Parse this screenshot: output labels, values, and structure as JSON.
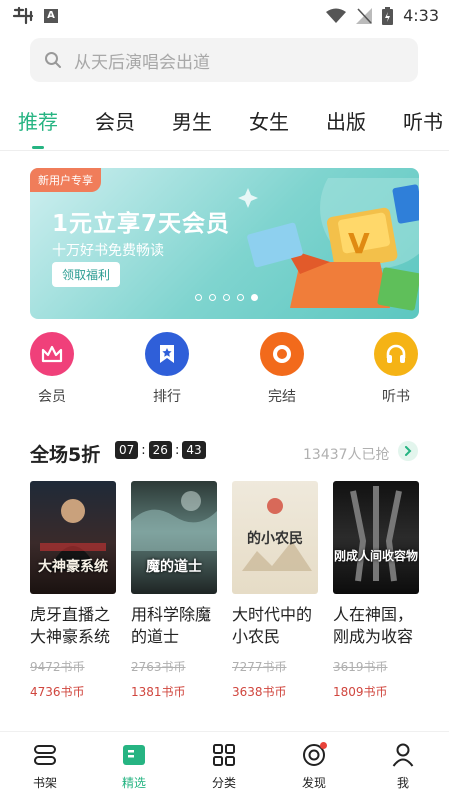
{
  "status_bar": {
    "time": "4:33",
    "app_mark": "A"
  },
  "search": {
    "placeholder": "从天后演唱会出道"
  },
  "tabs": [
    {
      "label": "推荐",
      "active": true
    },
    {
      "label": "会员"
    },
    {
      "label": "男生"
    },
    {
      "label": "女生"
    },
    {
      "label": "出版"
    },
    {
      "label": "听书"
    }
  ],
  "banner": {
    "tag": "新用户专享",
    "title": "1元立享7天会员",
    "subtitle": "十万好书免费畅读",
    "button": "领取福利",
    "slides": 5,
    "active_slide": 5
  },
  "quick_links": [
    {
      "label": "会员",
      "icon": "crown-icon",
      "color": "#f0407a"
    },
    {
      "label": "排行",
      "icon": "ranking-star-icon",
      "color": "#2f5fd9"
    },
    {
      "label": "完结",
      "icon": "ring-icon",
      "color": "#f26a1b"
    },
    {
      "label": "听书",
      "icon": "headphones-icon",
      "color": "#f5b315"
    }
  ],
  "flash_sale": {
    "title": "全场5折",
    "timer": [
      "07",
      "26",
      "43"
    ],
    "grabbed": "13437人已抢"
  },
  "books": [
    {
      "title": "虎牙直播之大神豪系统",
      "cover_text": "大神豪系统",
      "original_price": "9472书币",
      "price": "4736书币"
    },
    {
      "title": "用科学除魔的道士",
      "cover_text": "魔的道士",
      "original_price": "2763书币",
      "price": "1381书币"
    },
    {
      "title": "大时代中的小农民",
      "cover_text": "的小农民",
      "original_price": "7277书币",
      "price": "3638书币"
    },
    {
      "title": "人在神国，刚成为收容物",
      "cover_text": "刚成人间收容物",
      "original_price": "3619书币",
      "price": "1809书币"
    }
  ],
  "bottom_nav": [
    {
      "label": "书架",
      "icon": "bookshelf-icon"
    },
    {
      "label": "精选",
      "icon": "featured-icon",
      "active": true
    },
    {
      "label": "分类",
      "icon": "grid-icon"
    },
    {
      "label": "发现",
      "icon": "discover-icon",
      "badge": true
    },
    {
      "label": "我",
      "icon": "user-icon"
    }
  ],
  "colors": {
    "accent": "#26b482",
    "price": "#d0463e"
  }
}
